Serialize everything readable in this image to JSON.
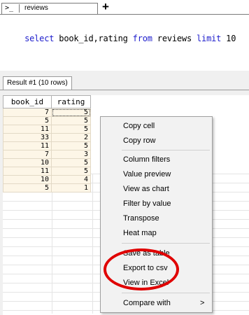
{
  "tabs": {
    "prompt": ">_",
    "active": "reviews",
    "add": "+"
  },
  "editor": {
    "tokens": [
      {
        "t": "select",
        "kw": true
      },
      {
        "t": " book_id,rating ",
        "kw": false
      },
      {
        "t": "from",
        "kw": true
      },
      {
        "t": " reviews ",
        "kw": false
      },
      {
        "t": "limit",
        "kw": true
      },
      {
        "t": " 10",
        "kw": false
      }
    ]
  },
  "results": {
    "tab_label": "Result #1 (10 rows)",
    "columns": [
      "book_id",
      "rating"
    ],
    "rows": [
      [
        "7",
        "5"
      ],
      [
        "5",
        "5"
      ],
      [
        "11",
        "5"
      ],
      [
        "33",
        "2"
      ],
      [
        "11",
        "5"
      ],
      [
        "7",
        "3"
      ],
      [
        "10",
        "5"
      ],
      [
        "11",
        "5"
      ],
      [
        "10",
        "4"
      ],
      [
        "5",
        "1"
      ]
    ]
  },
  "context_menu": {
    "groups": [
      [
        "Copy cell",
        "Copy row"
      ],
      [
        "Column filters",
        "Value preview",
        "View as chart",
        "Filter by value",
        "Transpose",
        "Heat map"
      ],
      [
        "Save as table",
        "Export to csv",
        "View in Excel"
      ],
      [
        "Compare with"
      ]
    ],
    "submenu_arrow": ">",
    "highlight_color": "#e00000"
  }
}
